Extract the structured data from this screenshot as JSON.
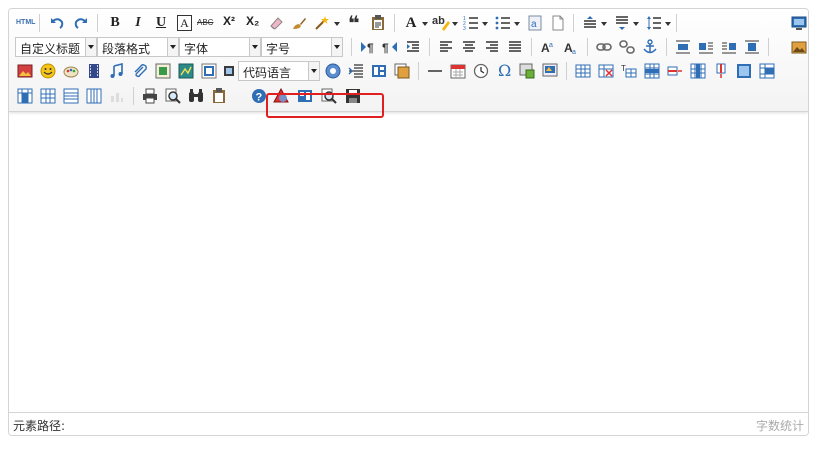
{
  "colors": {
    "accent_red": "#e02020",
    "icon_blue": "#2f6db5",
    "border": "#d4d4d4"
  },
  "toolbar": {
    "source_label": "HTML",
    "bold_label": "B",
    "italic_label": "I",
    "underline_label": "U",
    "fontborder_label": "A",
    "strike_label": "ABC",
    "superscript_label": "X²",
    "subscript_label": "X₂",
    "forecolor_label": "A",
    "customstyle": "自定义标题",
    "paragraph": "段落格式",
    "fontfamily": "字体",
    "fontsize": "字号",
    "code_language": "代码语言"
  },
  "statusbar": {
    "element_path": "元素路径:",
    "word_count": "字数统计"
  }
}
